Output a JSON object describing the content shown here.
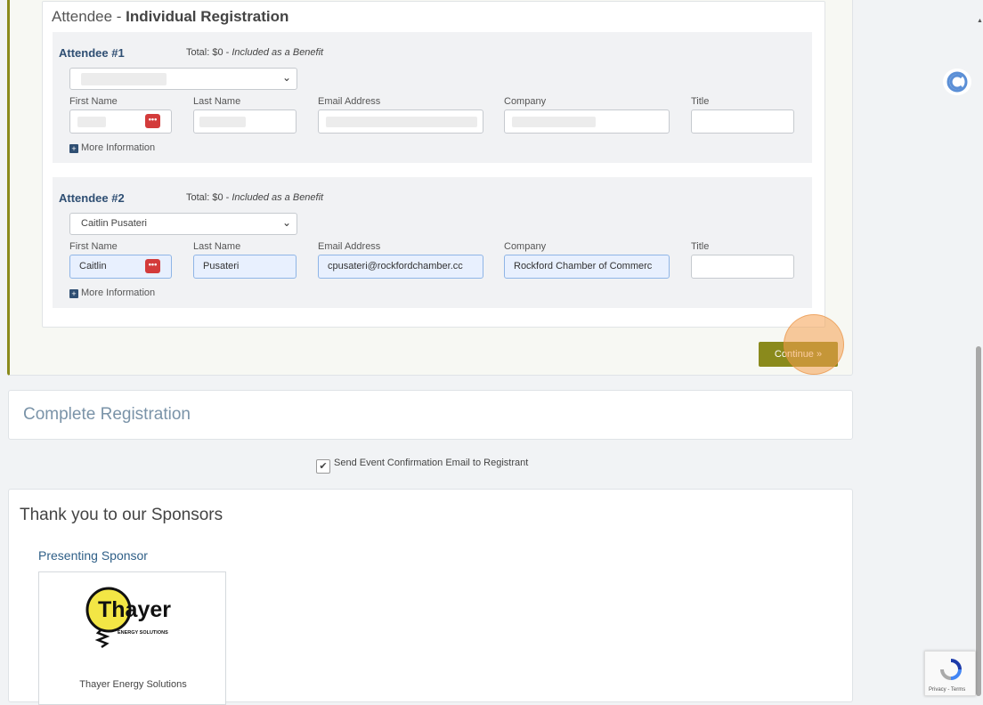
{
  "section": {
    "prefix": "Attendee - ",
    "title": "Individual Registration"
  },
  "attendees": [
    {
      "header": "Attendee #1",
      "total": "Total: $0 - ",
      "benefit": "Included as a Benefit",
      "select_value": "",
      "first_name": "",
      "last_name": "",
      "email": "",
      "company": "",
      "title": "",
      "more": "More Information"
    },
    {
      "header": "Attendee #2",
      "total": "Total: $0 - ",
      "benefit": "Included as a Benefit",
      "select_value": "Caitlin Pusateri",
      "first_name": "Caitlin",
      "last_name": "Pusateri",
      "email": "cpusateri@rockfordchamber.cc",
      "company": "Rockford Chamber of Commerc",
      "title": "",
      "more": "More Information"
    }
  ],
  "labels": {
    "first": "First Name",
    "last": "Last Name",
    "email": "Email Address",
    "company": "Company",
    "title": "Title"
  },
  "continue_label": "Continue »",
  "complete": {
    "title": "Complete Registration"
  },
  "confirm": {
    "label": "Send Event Confirmation Email to Registrant",
    "checked": true
  },
  "sponsors": {
    "title": "Thank you to our Sponsors",
    "level": "Presenting Sponsor",
    "logo_text": "Thayer",
    "logo_sub": "ENERGY SOLUTIONS",
    "name": "Thayer Energy Solutions"
  },
  "recaptcha": {
    "text": "Privacy - Terms"
  },
  "colors": {
    "accent": "#8a8a1c",
    "heading": "#2f4f73",
    "autofill": "#e8f0fe"
  }
}
